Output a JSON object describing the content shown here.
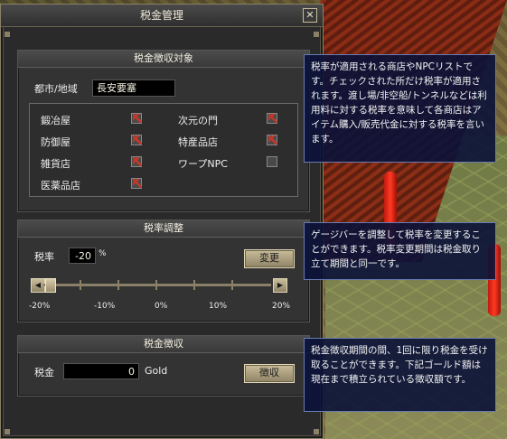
{
  "window": {
    "title": "税金管理",
    "close_label": "✕"
  },
  "collection_target": {
    "header": "税金徴収対象",
    "city_label": "都市/地域",
    "city_value": "長安要塞",
    "stores": [
      {
        "label": "鍛冶屋",
        "checked": true
      },
      {
        "label": "次元の門",
        "checked": true
      },
      {
        "label": "防御屋",
        "checked": true
      },
      {
        "label": "特産品店",
        "checked": true
      },
      {
        "label": "雑貨店",
        "checked": true
      },
      {
        "label": "ワープNPC",
        "checked": false
      },
      {
        "label": "医薬品店",
        "checked": true
      }
    ]
  },
  "rate_adjust": {
    "header": "税率調整",
    "rate_label": "税率",
    "rate_value": "-20",
    "unit": "%",
    "change_button": "変更",
    "slider_value": -20,
    "slider_min": -20,
    "slider_max": 20,
    "scale_labels": [
      "-20%",
      "-10%",
      "0%",
      "10%",
      "20%"
    ]
  },
  "collection": {
    "header": "税金徴収",
    "tax_label": "税金",
    "tax_value": "0",
    "tax_unit": "Gold",
    "collect_button": "徴収"
  },
  "tooltips": {
    "target": "税率が適用される商店やNPCリストです。チェックされた所だけ税率が適用されます。渡し場/非空船/トンネルなどは利用料に対する税率を意味して各商店はアイテム購入/販売代金に対する税率を言います。",
    "rate": "ゲージバーを調整して税率を変更することができます。税率変更期間は税金取り立て期間と同一です。",
    "collect": "税金徴収期間の間、1回に限り税金を受け取ることができます。下記ゴールド額は現在まで積立られている徴収額です。"
  }
}
